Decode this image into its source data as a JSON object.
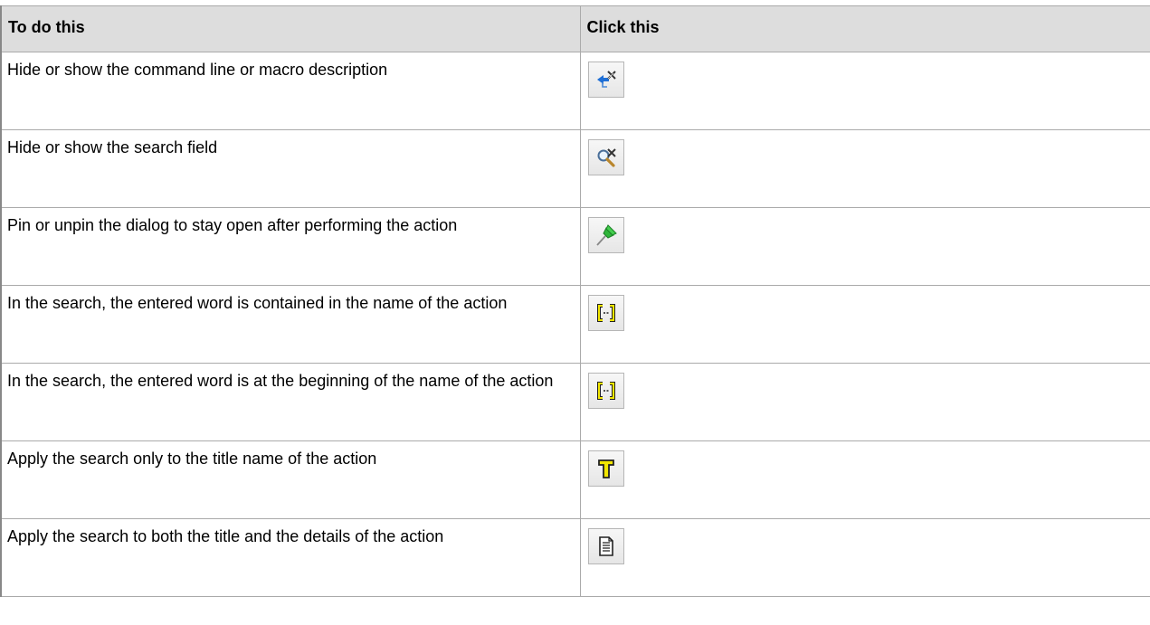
{
  "table": {
    "headers": {
      "col1": "To do this",
      "col2": "Click this"
    },
    "rows": [
      {
        "text": "Hide or show the command line or macro description",
        "icon": "hide-show-command-line-icon"
      },
      {
        "text": "Hide or show the search field",
        "icon": "hide-show-search-icon"
      },
      {
        "text": "Pin or unpin the dialog to stay open after performing the action",
        "icon": "pin-icon"
      },
      {
        "text": "In the search, the entered word is contained in the name of the action",
        "icon": "contains-bracket-icon"
      },
      {
        "text": "In the search, the entered word is at the beginning of the name of the action",
        "icon": "begins-with-bracket-icon"
      },
      {
        "text": "Apply the search only to the title name of the action",
        "icon": "title-t-icon"
      },
      {
        "text": "Apply the search to both the title and the details of the action",
        "icon": "document-icon"
      }
    ]
  },
  "colors": {
    "header_bg": "#dddddd",
    "border": "#aaaaaa",
    "icon_yellow": "#f2e600",
    "pin_green": "#2fb53a"
  }
}
